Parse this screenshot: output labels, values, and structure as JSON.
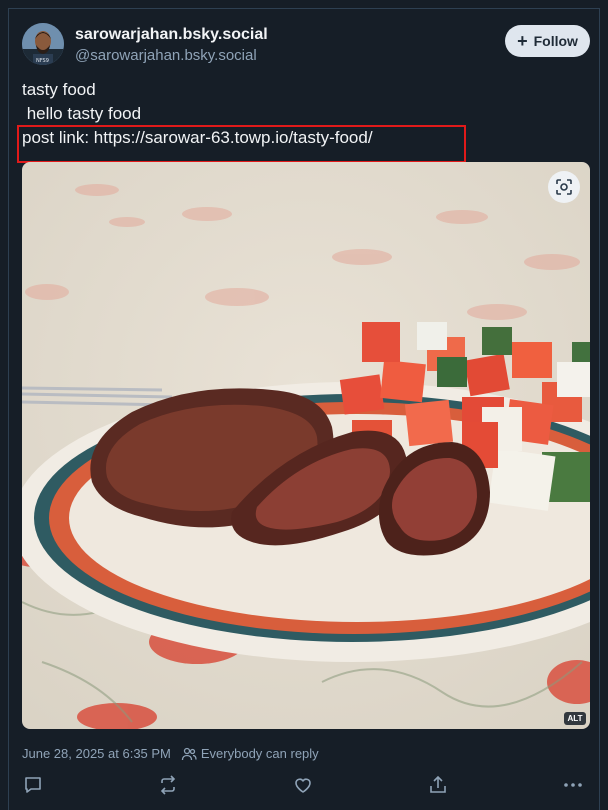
{
  "author": {
    "display_name": "sarowarjahan.bsky.social",
    "handle": "@sarowarjahan.bsky.social",
    "avatar_alt": "avatar"
  },
  "follow_button": {
    "label": "Follow",
    "icon": "plus-icon"
  },
  "post": {
    "lines": [
      "tasty food",
      " hello tasty food",
      "post link: https://sarowar-63.towp.io/tasty-food/"
    ],
    "highlight_color": "#e11a1a",
    "image": {
      "alt_badge": "ALT",
      "zoom_icon": "expand-viewfinder-icon",
      "description": "steak"
    },
    "timestamp": "June 28, 2025 at 6:35 PM",
    "reply_setting": "Everybody can reply"
  },
  "actions": [
    {
      "name": "reply",
      "icon": "speech-bubble-icon"
    },
    {
      "name": "repost",
      "icon": "repost-icon"
    },
    {
      "name": "like",
      "icon": "heart-icon"
    },
    {
      "name": "share",
      "icon": "share-icon"
    },
    {
      "name": "more",
      "icon": "ellipsis-icon"
    }
  ],
  "colors": {
    "background": "#161e27",
    "text_primary": "#f1f3f5",
    "text_secondary": "#8fa3b7",
    "follow_bg": "#dfe6ee"
  }
}
